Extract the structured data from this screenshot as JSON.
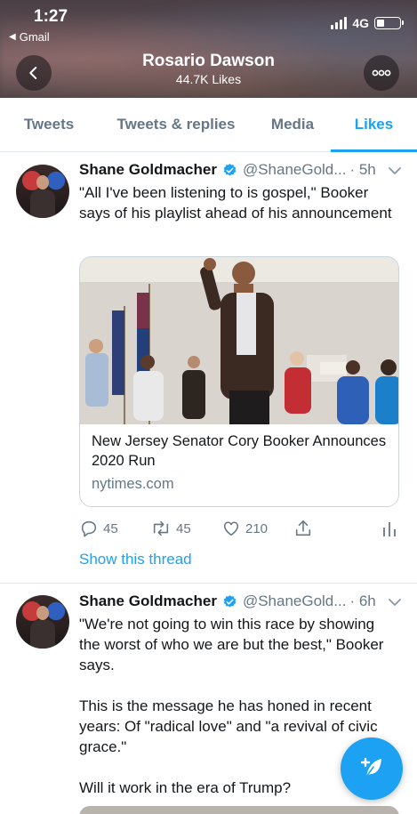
{
  "status_bar": {
    "time": "1:27",
    "back_app": "Gmail",
    "network": "4G"
  },
  "header": {
    "title": "Rosario Dawson",
    "subtitle": "44.7K Likes"
  },
  "tabs": [
    {
      "label": "Tweets",
      "active": false
    },
    {
      "label": "Tweets & replies",
      "active": false
    },
    {
      "label": "Media",
      "active": false
    },
    {
      "label": "Likes",
      "active": true
    }
  ],
  "tweets": [
    {
      "name": "Shane Goldmacher",
      "handle": "@ShaneGold...",
      "time": "· 5h",
      "text": "\"All I've been listening to is gospel,\" Booker says of his playlist ahead of his announcement",
      "card": {
        "title": "New Jersey Senator Cory Booker Announces 2020 Run",
        "domain": "nytimes.com"
      },
      "replies": "45",
      "retweets": "45",
      "likes": "210",
      "show_thread": "Show this thread"
    },
    {
      "name": "Shane Goldmacher",
      "handle": "@ShaneGold...",
      "time": "· 6h",
      "text": "\"We're not going to win this race by showing the worst of who we are but the best,\" Booker says.\n\nThis is the message he has honed in recent years: Of \"radical love\" and \"a revival of civic grace.\"\n\nWill it work in the era of Trump?"
    }
  ],
  "colors": {
    "accent": "#1da1f2",
    "secondary_text": "#657786",
    "verified": "#1da1f2"
  },
  "icons": [
    "back-arrow-icon",
    "more-icon",
    "verified-icon",
    "chevron-down-icon",
    "reply-icon",
    "retweet-icon",
    "like-icon",
    "share-icon",
    "analytics-icon",
    "compose-icon"
  ]
}
